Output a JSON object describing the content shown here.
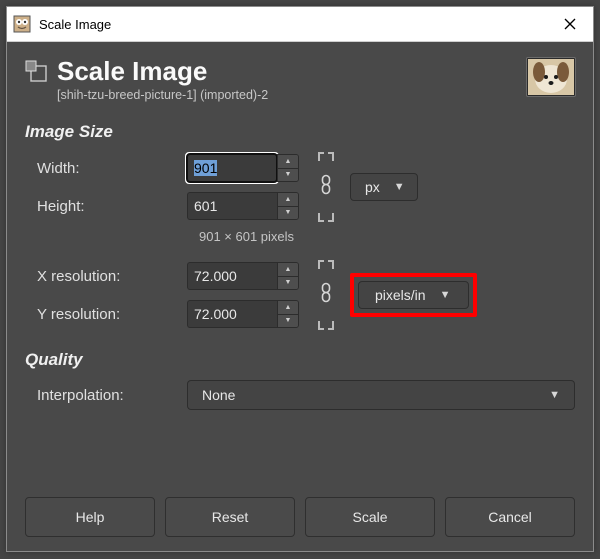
{
  "os_title": "Scale Image",
  "header": {
    "title": "Scale Image",
    "subtitle": "[shih-tzu-breed-picture-1] (imported)-2"
  },
  "sections": {
    "image_size": "Image Size",
    "quality": "Quality"
  },
  "labels": {
    "width": "Width:",
    "height": "Height:",
    "xres": "X resolution:",
    "yres": "Y resolution:",
    "interpolation": "Interpolation:"
  },
  "values": {
    "width": "901",
    "height": "601",
    "xres": "72.000",
    "yres": "72.000",
    "pixel_note": "901 × 601 pixels",
    "unit_size": "px",
    "unit_res": "pixels/in",
    "interpolation": "None"
  },
  "buttons": {
    "help": "Help",
    "reset": "Reset",
    "scale": "Scale",
    "cancel": "Cancel"
  }
}
